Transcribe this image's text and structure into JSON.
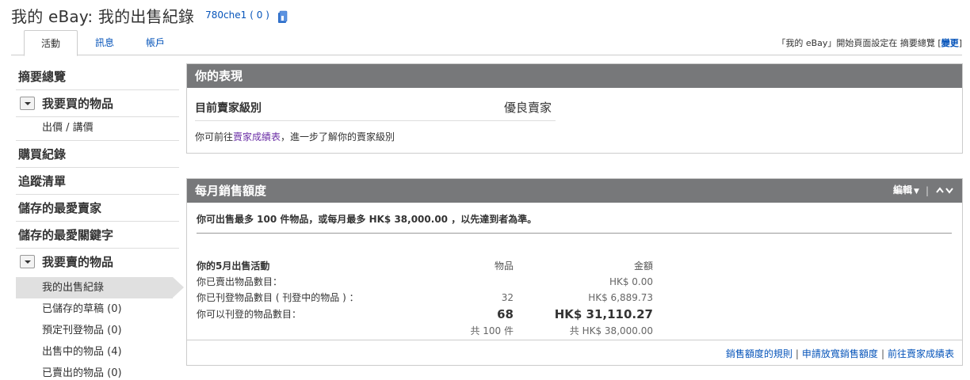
{
  "header": {
    "title": "我的 eBay: 我的出售紀錄",
    "username": "780che1",
    "score": "( 0 )"
  },
  "tabs": {
    "activity": "活動",
    "messages": "訊息",
    "account": "帳戶",
    "homepage_note_prefix": "「我的 eBay」開始頁面設定在 摘要總覽 [",
    "homepage_change": "變更",
    "homepage_note_suffix": "]"
  },
  "sidebar": {
    "summary": "摘要總覽",
    "buying_group": "我要買的物品",
    "bids_offers": "出價 / 講價",
    "purchase_history": "購買紀錄",
    "watch_list": "追蹤清單",
    "saved_sellers": "儲存的最愛賣家",
    "saved_searches": "儲存的最愛關鍵字",
    "selling_group": "我要賣的物品",
    "selling_items": [
      "我的出售紀錄",
      "已儲存的草稿 (0)",
      "預定刊登物品 (0)",
      "出售中的物品 (4)",
      "已賣出的物品 (0)"
    ]
  },
  "performance": {
    "title": "你的表現",
    "level_label": "目前賣家級別",
    "level_value": "優良賣家",
    "note_prefix": "你可前往",
    "note_link": "賣家成績表",
    "note_suffix": "，進一步了解你的賣家級別"
  },
  "limits": {
    "title": "每月銷售額度",
    "edit": "編輯",
    "limit_text": "你可出售最多 100 件物品，或每月最多 HK$ 38,000.00 ，以先達到者為準。",
    "table": {
      "header": [
        "你的5月出售活動",
        "物品",
        "金額"
      ],
      "rows": [
        [
          "你已賣出物品數目：",
          "",
          "HK$ 0.00"
        ],
        [
          "你已刊登物品數目 ( 刊登中的物品 ) ：",
          "32",
          "HK$ 6,889.73"
        ],
        [
          "你可以刊登的物品數目：",
          "68",
          "HK$ 31,110.27"
        ],
        [
          "",
          "共 100 件",
          "共 HK$ 38,000.00"
        ]
      ]
    },
    "footer": {
      "rules": "銷售額度的規則",
      "request": "申請放寬銷售額度",
      "scorecard": "前往賣家成績表",
      "sep": "|"
    }
  }
}
